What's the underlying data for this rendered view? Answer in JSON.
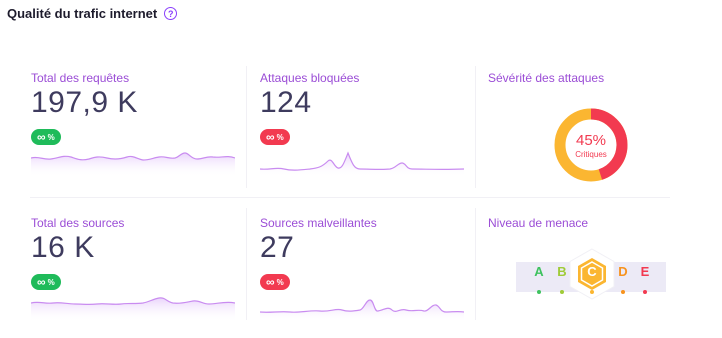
{
  "header": {
    "title": "Qualité du trafic internet",
    "help_glyph": "?"
  },
  "colors": {
    "accent": "#9b4dd6",
    "badge_green": "#1fbb5a",
    "badge_red": "#f23a50",
    "spark_line": "#c98cf0",
    "donut_red": "#f23a50",
    "donut_orange": "#fbb631"
  },
  "cards": {
    "requests": {
      "title": "Total des requêtes",
      "value": "197,9 K",
      "badge": "%",
      "badge_icon": "infinity-icon"
    },
    "blocked": {
      "title": "Attaques bloquées",
      "value": "124",
      "badge": "%",
      "badge_icon": "infinity-icon"
    },
    "severity": {
      "title": "Sévérité des attaques",
      "percent": "45%",
      "label": "Critiques",
      "fraction_critical": 0.45
    },
    "sources": {
      "title": "Total des sources",
      "value": "16 K",
      "badge": "%",
      "badge_icon": "infinity-icon"
    },
    "malicious": {
      "title": "Sources malveillantes",
      "value": "27",
      "badge": "%",
      "badge_icon": "infinity-icon"
    },
    "threat": {
      "title": "Niveau de menace",
      "grades": [
        "A",
        "B",
        "C",
        "D",
        "E"
      ],
      "active": "C"
    }
  }
}
